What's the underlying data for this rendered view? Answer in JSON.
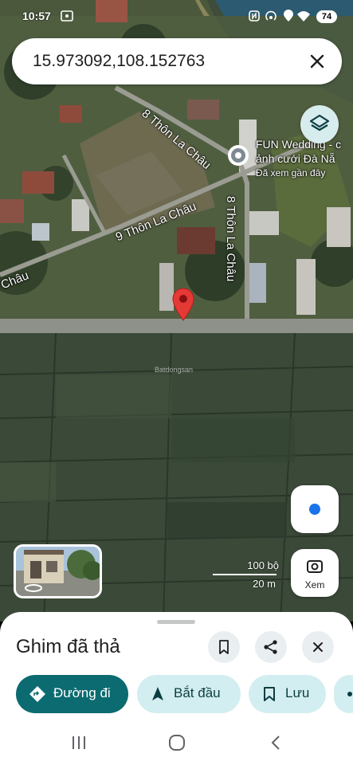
{
  "status_bar": {
    "time": "10:57",
    "battery": "74"
  },
  "search": {
    "query": "15.973092,108.152763"
  },
  "map": {
    "streets": [
      "8 Thôn La Châu",
      "9 Thôn La Châu",
      "8 Thôn La Châu",
      "Châu"
    ],
    "poi": {
      "title_line1": "FUN Wedding - c",
      "title_line2": "ảnh cưới Đà Nẵ",
      "subtitle": "Đã xem gần đây"
    },
    "watermark": "Batdongsan",
    "scale": {
      "imperial": "100 bộ",
      "metric": "20 m"
    },
    "lens_label": "Xem"
  },
  "sheet": {
    "title": "Ghim đã thả",
    "chips": [
      "Đường đi",
      "Bắt đầu",
      "Lưu"
    ]
  },
  "colors": {
    "primary": "#0b6b70",
    "chip": "#d3eef0",
    "pin": "#e53935",
    "location": "#1a73e8"
  }
}
